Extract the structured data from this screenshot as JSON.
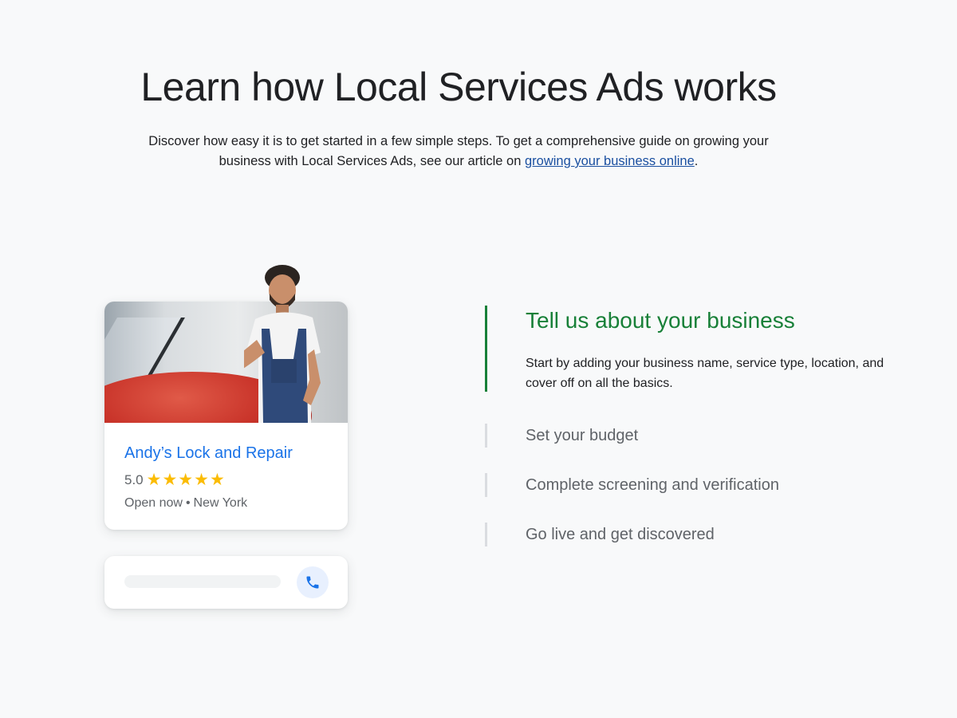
{
  "header": {
    "title": "Learn how Local Services Ads works",
    "intro_text": "Discover how easy it is to get started in a few simple steps. To get a comprehensive guide on growing your business with Local Services Ads, see our article on ",
    "intro_link": "growing your business online",
    "intro_end": "."
  },
  "listing": {
    "business_name": "Andy’s Lock and Repair",
    "rating": "5.0",
    "stars": "★★★★★",
    "stars_count": 5,
    "status": "Open now",
    "separator": "•",
    "location": "New York",
    "call_icon": "phone-icon"
  },
  "steps": [
    {
      "title": "Tell us about your business",
      "body": "Start by adding your business name, service type, location, and cover off on all the basics.",
      "active": true
    },
    {
      "title": "Set your budget",
      "active": false
    },
    {
      "title": "Complete screening and verification",
      "active": false
    },
    {
      "title": "Go live and get discovered",
      "active": false
    }
  ],
  "colors": {
    "background": "#f8f9fa",
    "link": "#1a4fa0",
    "business_name": "#1a73e8",
    "star": "#fbbc04",
    "active_step": "#188038",
    "inactive_divider": "#dadce0"
  }
}
